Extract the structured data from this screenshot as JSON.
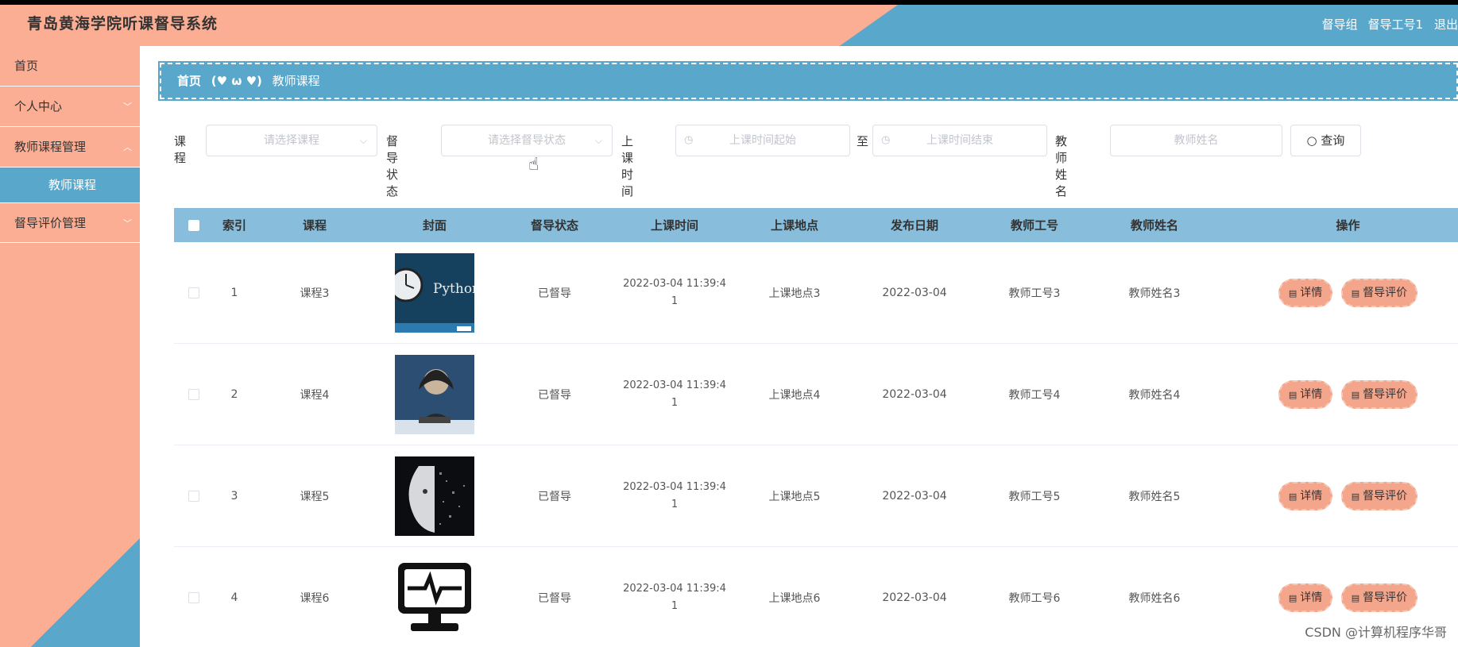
{
  "header": {
    "title": "青岛黄海学院听课督导系统",
    "role": "督导组",
    "username": "督导工号1",
    "logout": "退出"
  },
  "sidebar": {
    "items": [
      {
        "label": "首页"
      },
      {
        "label": "个人中心",
        "chevron": "﹀"
      },
      {
        "label": "教师课程管理",
        "chevron": "︿"
      },
      {
        "label": "教师课程",
        "sub": true
      },
      {
        "label": "督导评价管理",
        "chevron": "﹀"
      }
    ]
  },
  "breadcrumb": {
    "home": "首页",
    "separator": "(♥ ω ♥)",
    "current": "教师课程"
  },
  "filters": {
    "course_label": "课程",
    "course_placeholder": "请选择课程",
    "status_label": "督导状态",
    "status_placeholder": "请选择督导状态",
    "time_label": "上课时间",
    "time_start_placeholder": "上课时间起始",
    "to_label": "至",
    "time_end_placeholder": "上课时间结束",
    "teacher_label": "教师姓名",
    "teacher_placeholder": "教师姓名",
    "search_label": "查询"
  },
  "table": {
    "columns": [
      "索引",
      "课程",
      "封面",
      "督导状态",
      "上课时间",
      "上课地点",
      "发布日期",
      "教师工号",
      "教师姓名",
      "操作"
    ],
    "rows": [
      {
        "index": "1",
        "course": "课程3",
        "cover": "python-icon",
        "status": "已督导",
        "time_a": "2022-03-04 11:39:4",
        "time_b": "1",
        "place": "上课地点3",
        "date": "2022-03-04",
        "tno": "教师工号3",
        "tname": "教师姓名3"
      },
      {
        "index": "2",
        "course": "课程4",
        "cover": "hacker-icon",
        "status": "已督导",
        "time_a": "2022-03-04 11:39:4",
        "time_b": "1",
        "place": "上课地点4",
        "date": "2022-03-04",
        "tno": "教师工号4",
        "tname": "教师姓名4"
      },
      {
        "index": "3",
        "course": "课程5",
        "cover": "robot-face-icon",
        "status": "已督导",
        "time_a": "2022-03-04 11:39:4",
        "time_b": "1",
        "place": "上课地点5",
        "date": "2022-03-04",
        "tno": "教师工号5",
        "tname": "教师姓名5"
      },
      {
        "index": "4",
        "course": "课程6",
        "cover": "monitor-icon",
        "status": "已督导",
        "time_a": "2022-03-04 11:39:4",
        "time_b": "1",
        "place": "上课地点6",
        "date": "2022-03-04",
        "tno": "教师工号6",
        "tname": "教师姓名6"
      }
    ],
    "detail_label": "详情",
    "evaluate_label": "督导评价"
  },
  "watermark": "CSDN @计算机程序华哥",
  "colors": {
    "peach": "#fbae93",
    "blue": "#5aa7cc",
    "header_row": "#88bedb",
    "button": "#f3a68b"
  }
}
